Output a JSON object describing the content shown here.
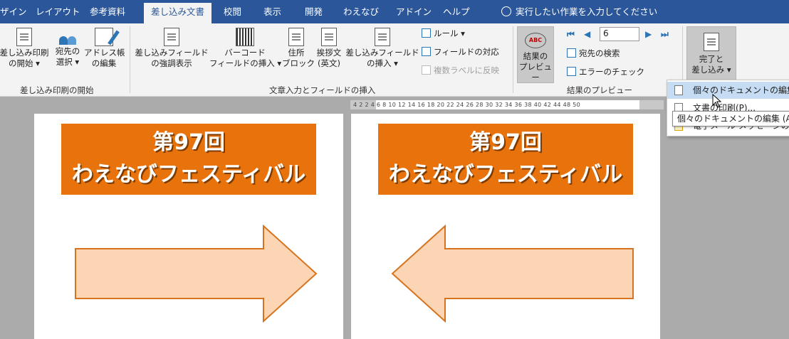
{
  "tabs": [
    {
      "label": "ザイン"
    },
    {
      "label": "レイアウト"
    },
    {
      "label": "参考資料"
    },
    {
      "label": "差し込み文書"
    },
    {
      "label": "校閲"
    },
    {
      "label": "表示"
    },
    {
      "label": "開発"
    },
    {
      "label": "わえなび"
    },
    {
      "label": "アドイン"
    },
    {
      "label": "ヘルプ"
    }
  ],
  "tell_me": "実行したい作業を入力してください",
  "ribbon": {
    "start_group": {
      "start_merge": [
        "差し込み印刷",
        "の開始 ▾"
      ],
      "select_recipients": [
        "宛先の",
        "選択 ▾"
      ],
      "edit_list": [
        "アドレス帳",
        "の編集"
      ],
      "label": "差し込み印刷の開始"
    },
    "fields_group": {
      "highlight": [
        "差し込みフィールド",
        "の強調表示"
      ],
      "barcode": [
        "バーコード",
        "フィールドの挿入 ▾"
      ],
      "address_block": [
        "住所",
        "ブロック"
      ],
      "greeting": [
        "挨拶文",
        "(英文)"
      ],
      "insert_field": [
        "差し込みフィールド",
        "の挿入 ▾"
      ],
      "rules": "ルール ▾",
      "match_fields": "フィールドの対応",
      "update_labels": "複数ラベルに反映",
      "label": "文章入力とフィールドの挿入"
    },
    "preview_group": {
      "preview_results": [
        "結果の",
        "プレビュー"
      ],
      "record": "6",
      "find_recipient": "宛先の検索",
      "check_errors": "エラーのチェック",
      "label": "結果のプレビュー"
    },
    "finish_group": {
      "finish": [
        "完了と",
        "差し込み ▾"
      ]
    }
  },
  "ruler": "4 2   2 4 6 8 10 12 14 16 18 20 22 24 26 28 30 32 34 36 38 40 42 44   48 50",
  "pages": [
    {
      "line1": "第97回",
      "line2": "わえなびフェスティバル",
      "arrow": "right"
    },
    {
      "line1": "第97回",
      "line2": "わえなびフェスティバル",
      "arrow": "left"
    }
  ],
  "dropdown": {
    "items": [
      "個々のドキュメントの編集(E)...",
      "文書の印刷(P)...",
      "電子メール メッセージの送信(S)..."
    ]
  },
  "tooltip": "個々のドキュメントの編集 (Alt+Shift+N)",
  "colors": {
    "tabbar": "#2b579a",
    "banner": "#e8730c",
    "arrow_fill": "#fcd5b5",
    "arrow_stroke": "#d6731f"
  }
}
